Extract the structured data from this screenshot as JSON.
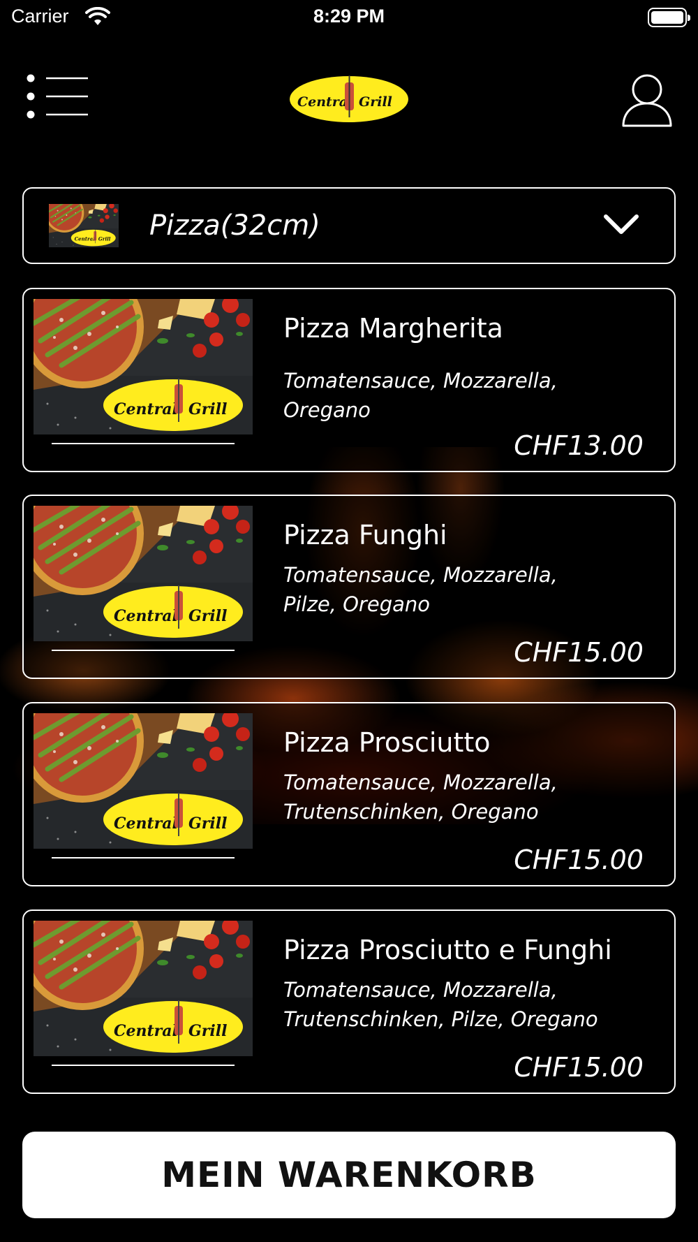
{
  "status_bar": {
    "carrier": "Carrier",
    "time": "8:29 PM"
  },
  "header": {
    "menu_icon": "menu-list-icon",
    "logo_text_left": "Central",
    "logo_text_right": "Grill",
    "profile_icon": "user-icon"
  },
  "category": {
    "label": "Pizza(32cm)",
    "chevron_icon": "chevron-down-icon"
  },
  "products": [
    {
      "name": "Pizza Margherita",
      "description": "Tomatensauce, Mozzarella, Oregano",
      "price": "CHF13.00"
    },
    {
      "name": "Pizza Funghi",
      "description_line1": "Tomatensauce, Mozzarella,",
      "description_line2": "Pilze, Oregano",
      "price": "CHF15.00"
    },
    {
      "name": "Pizza Prosciutto",
      "description_line1": "Tomatensauce, Mozzarella,",
      "description_line2": "Trutenschinken, Oregano",
      "price": "CHF15.00"
    },
    {
      "name": "Pizza Prosciutto e Funghi",
      "description_line1": "Tomatensauce, Mozzarella,",
      "description_line2": "Trutenschinken, Pilze, Oregano",
      "price": "CHF15.00"
    }
  ],
  "cart": {
    "label": "MEIN WARENKORB"
  },
  "colors": {
    "background": "#000000",
    "logo_yellow": "#FFEC1E",
    "text": "#FFFFFF",
    "button_bg": "#FFFFFF"
  }
}
